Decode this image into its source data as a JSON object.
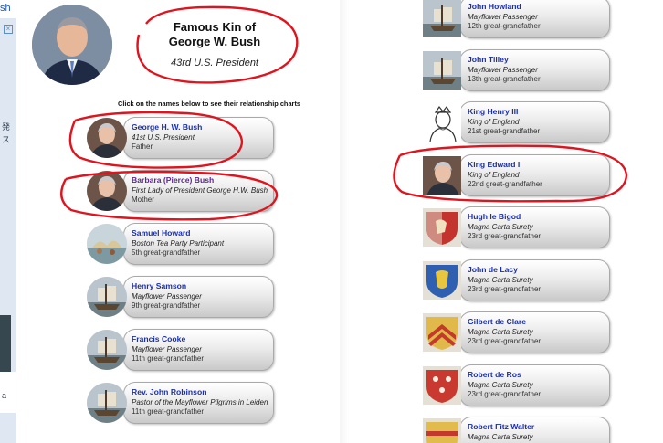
{
  "browser": {
    "tab_fragment": "sh",
    "sidebar_glyphs": [
      "発",
      "ス",
      "a"
    ],
    "sidebar_glyph_tops": [
      "132px",
      "146px",
      "428px"
    ]
  },
  "header": {
    "title_line1": "Famous Kin of",
    "title_line2": "George W. Bush",
    "subtitle": "43rd U.S. President",
    "instruction": "Click on the names below to see their relationship charts"
  },
  "left_cards": [
    {
      "name": "George H. W. Bush",
      "role": "41st U.S. President",
      "relation": "Father",
      "visited": false,
      "icon": "portrait-icon"
    },
    {
      "name": "Barbara (Pierce) Bush",
      "role": "First Lady of President George H.W. Bush",
      "relation": "Mother",
      "visited": true,
      "icon": "portrait-icon"
    },
    {
      "name": "Samuel Howard",
      "role": "Boston Tea Party Participant",
      "relation": "5th great-grandfather",
      "visited": false,
      "icon": "painting-icon"
    },
    {
      "name": "Henry Samson",
      "role": "Mayflower Passenger",
      "relation": "9th great-grandfather",
      "visited": false,
      "icon": "ship-icon"
    },
    {
      "name": "Francis Cooke",
      "role": "Mayflower Passenger",
      "relation": "11th great-grandfather",
      "visited": false,
      "icon": "ship-icon"
    },
    {
      "name": "Rev. John Robinson",
      "role": "Pastor of the Mayflower Pilgrims in Leiden",
      "relation": "11th great-grandfather",
      "visited": false,
      "icon": "ship-icon"
    }
  ],
  "right_cards": [
    {
      "name": "John Howland",
      "role": "Mayflower Passenger",
      "relation": "12th great-grandfather",
      "icon": "ship-icon"
    },
    {
      "name": "John Tilley",
      "role": "Mayflower Passenger",
      "relation": "13th great-grandfather",
      "icon": "ship-icon"
    },
    {
      "name": "King Henry III",
      "role": "King of England",
      "relation": "21st great-grandfather",
      "icon": "king-sketch-icon"
    },
    {
      "name": "King Edward I",
      "role": "King of England",
      "relation": "22nd great-grandfather",
      "icon": "portrait-icon"
    },
    {
      "name": "Hugh le Bigod",
      "role": "Magna Carta Surety",
      "relation": "23rd great-grandfather",
      "icon": "shield-red-lion-icon"
    },
    {
      "name": "John de Lacy",
      "role": "Magna Carta Surety",
      "relation": "23rd great-grandfather",
      "icon": "shield-blue-icon"
    },
    {
      "name": "Gilbert de Clare",
      "role": "Magna Carta Surety",
      "relation": "23rd great-grandfather",
      "icon": "shield-chevron-icon"
    },
    {
      "name": "Robert de Ros",
      "role": "Magna Carta Surety",
      "relation": "23rd great-grandfather",
      "icon": "shield-red-icon"
    },
    {
      "name": "Robert Fitz Walter",
      "role": "Magna Carta Surety",
      "relation": "",
      "icon": "shield-gold-icon"
    }
  ],
  "colors": {
    "link": "#1b2fa8",
    "visited_link": "#5b2a8a",
    "annotation": "#e0141e"
  }
}
